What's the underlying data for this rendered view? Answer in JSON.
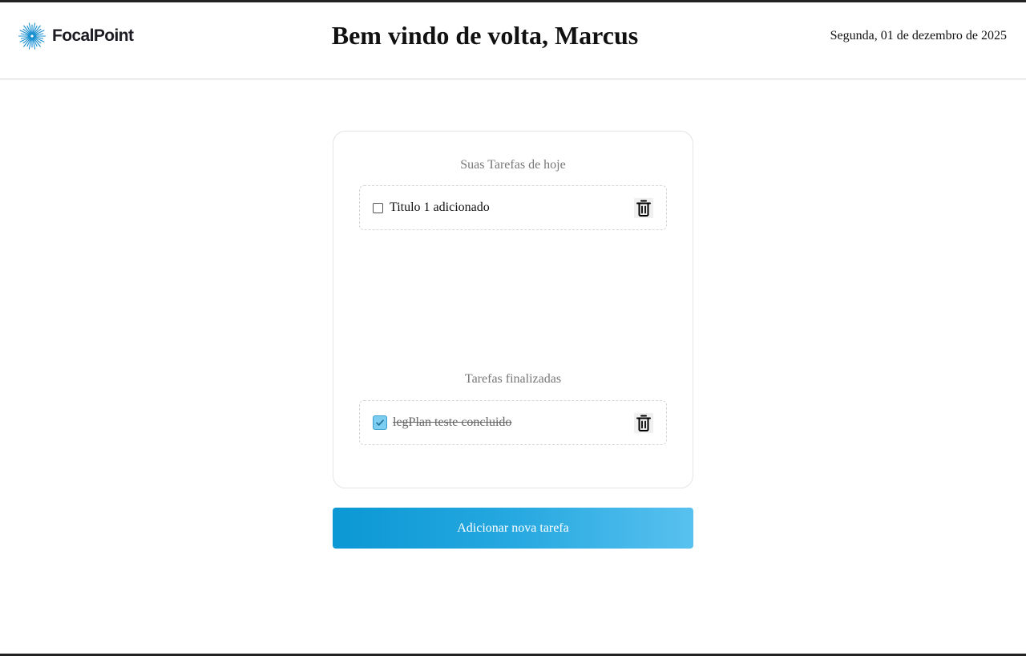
{
  "header": {
    "brand": "FocalPoint",
    "logo_icon": "starburst-logo-icon",
    "title": "Bem vindo de volta, Marcus",
    "date": "Segunda, 01 de dezembro de 2025"
  },
  "tasks": {
    "today_title": "Suas Tarefas de hoje",
    "today": [
      {
        "label": "Titulo 1 adicionado",
        "checked": false,
        "delete_icon": "trash-icon"
      }
    ],
    "finished_title": "Tarefas finalizadas",
    "finished": [
      {
        "label": "legPlan teste concluido",
        "checked": true,
        "delete_icon": "trash-icon"
      }
    ]
  },
  "add_button": {
    "label": "Adicionar nova tarefa"
  },
  "colors": {
    "accent_start": "#0b98d4",
    "accent_end": "#58c1ef",
    "logo": "#1a8fd0",
    "checked_fill": "#7ccdf0"
  }
}
